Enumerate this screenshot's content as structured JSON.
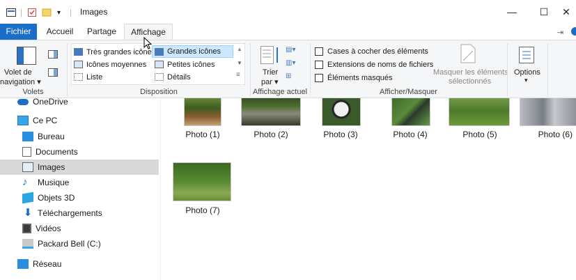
{
  "window": {
    "title": "Images",
    "minimize": "—",
    "maximize": "☐",
    "close": "✕"
  },
  "tabs": [
    {
      "label": "Fichier"
    },
    {
      "label": "Accueil"
    },
    {
      "label": "Partage"
    },
    {
      "label": "Affichage"
    }
  ],
  "ribbon": {
    "panes": {
      "nav_pane_label": "Volet de",
      "nav_pane_label2": "navigation",
      "group_label": "Volets"
    },
    "layout": {
      "items": [
        {
          "label": "Très grandes icônes"
        },
        {
          "label": "Grandes icônes"
        },
        {
          "label": "Icônes moyennes"
        },
        {
          "label": "Petites icônes"
        },
        {
          "label": "Liste"
        },
        {
          "label": "Détails"
        }
      ],
      "group_label": "Disposition"
    },
    "current_view": {
      "sort_label": "Trier",
      "sort_label2": "par",
      "group_label": "Affichage actuel"
    },
    "show_hide": {
      "checkboxes": [
        {
          "label": "Cases à cocher des éléments"
        },
        {
          "label": "Extensions de noms de fichiers"
        },
        {
          "label": "Éléments masqués"
        }
      ],
      "hide_selected": "Masquer les éléments",
      "hide_selected2": "sélectionnés",
      "group_label": "Afficher/Masquer"
    },
    "options_label": "Options"
  },
  "nav": {
    "items": [
      {
        "label": "OneDrive"
      },
      {
        "label": "Ce PC"
      },
      {
        "label": "Bureau"
      },
      {
        "label": "Documents"
      },
      {
        "label": "Images"
      },
      {
        "label": "Musique"
      },
      {
        "label": "Objets 3D"
      },
      {
        "label": "Téléchargements"
      },
      {
        "label": "Vidéos"
      },
      {
        "label": "Packard Bell (C:)"
      },
      {
        "label": "Réseau"
      }
    ]
  },
  "files": [
    {
      "label": "Photo (1)"
    },
    {
      "label": "Photo (2)"
    },
    {
      "label": "Photo (3)"
    },
    {
      "label": "Photo (4)"
    },
    {
      "label": "Photo (5)"
    },
    {
      "label": "Photo (6)"
    },
    {
      "label": "Photo (7)"
    }
  ]
}
